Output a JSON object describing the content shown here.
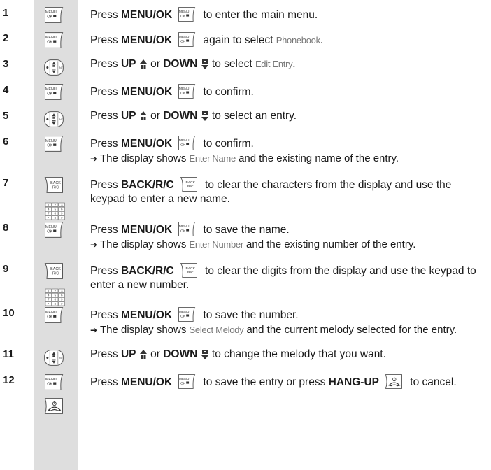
{
  "steps": [
    {
      "num": "1",
      "icons": [
        "menu-ok"
      ],
      "parts": [
        {
          "t": "Press "
        },
        {
          "b": "MENU/OK"
        },
        {
          "i": "menu-ok"
        },
        {
          "t": " to enter the main menu."
        }
      ]
    },
    {
      "num": "2",
      "icons": [
        "menu-ok"
      ],
      "parts": [
        {
          "t": "Press "
        },
        {
          "b": "MENU/OK"
        },
        {
          "i": "menu-ok"
        },
        {
          "t": " again to select "
        },
        {
          "k": "Phonebook"
        },
        {
          "t": "."
        }
      ]
    },
    {
      "num": "3",
      "icons": [
        "nav"
      ],
      "parts": [
        {
          "t": "Press "
        },
        {
          "b": "UP"
        },
        {
          "t": " "
        },
        {
          "i": "up"
        },
        {
          "t": " or "
        },
        {
          "b": "DOWN"
        },
        {
          "t": " "
        },
        {
          "i": "down"
        },
        {
          "t": " to select "
        },
        {
          "k": "Edit Entry"
        },
        {
          "t": "."
        }
      ]
    },
    {
      "num": "4",
      "icons": [
        "menu-ok"
      ],
      "parts": [
        {
          "t": "Press "
        },
        {
          "b": "MENU/OK"
        },
        {
          "i": "menu-ok"
        },
        {
          "t": " to confirm."
        }
      ]
    },
    {
      "num": "5",
      "icons": [
        "nav"
      ],
      "parts": [
        {
          "t": "Press "
        },
        {
          "b": "UP"
        },
        {
          "t": " "
        },
        {
          "i": "up"
        },
        {
          "t": " or "
        },
        {
          "b": "DOWN"
        },
        {
          "t": " "
        },
        {
          "i": "down"
        },
        {
          "t": " to select an entry."
        }
      ]
    },
    {
      "num": "6",
      "icons": [
        "menu-ok"
      ],
      "parts": [
        {
          "t": "Press "
        },
        {
          "b": "MENU/OK"
        },
        {
          "i": "menu-ok"
        },
        {
          "t": " to confirm."
        }
      ],
      "sub": [
        {
          "t": "The display shows "
        },
        {
          "k": "Enter Name"
        },
        {
          "t": " and the existing name of the entry."
        }
      ]
    },
    {
      "num": "7",
      "icons": [
        "back",
        "keypad"
      ],
      "wrap": true,
      "parts": [
        {
          "t": "Press "
        },
        {
          "b": "BACK/R/C"
        },
        {
          "i": "back"
        },
        {
          "t": " to clear the characters from the display and use the keypad to enter a new name."
        }
      ]
    },
    {
      "num": "8",
      "icons": [
        "menu-ok"
      ],
      "parts": [
        {
          "t": "Press "
        },
        {
          "b": "MENU/OK"
        },
        {
          "i": "menu-ok"
        },
        {
          "t": " to save the name."
        }
      ],
      "sub": [
        {
          "t": "The display shows "
        },
        {
          "k": "Enter Number"
        },
        {
          "t": " and the existing number of the entry."
        }
      ]
    },
    {
      "num": "9",
      "icons": [
        "back",
        "keypad"
      ],
      "wrap": true,
      "parts": [
        {
          "t": "Press "
        },
        {
          "b": "BACK/R/C"
        },
        {
          "i": "back"
        },
        {
          "t": " to clear the digits from the display and use the keypad to enter a new number."
        }
      ]
    },
    {
      "num": "10",
      "icons": [
        "menu-ok"
      ],
      "parts": [
        {
          "t": "Press "
        },
        {
          "b": "MENU/OK"
        },
        {
          "i": "menu-ok"
        },
        {
          "t": " to save the number."
        }
      ],
      "sub": [
        {
          "t": "The display shows "
        },
        {
          "k": "Select Melody"
        },
        {
          "t": " and the current melody selected for the entry."
        }
      ]
    },
    {
      "num": "11",
      "icons": [
        "nav"
      ],
      "parts": [
        {
          "t": "Press "
        },
        {
          "b": "UP"
        },
        {
          "t": " "
        },
        {
          "i": "up"
        },
        {
          "t": " or "
        },
        {
          "b": "DOWN"
        },
        {
          "t": " "
        },
        {
          "i": "down"
        },
        {
          "t": " to change the melody that you want."
        }
      ]
    },
    {
      "num": "12",
      "icons": [
        "menu-ok",
        "hangup"
      ],
      "wrap": true,
      "parts": [
        {
          "t": "Press "
        },
        {
          "b": "MENU/OK"
        },
        {
          "i": "menu-ok"
        },
        {
          "t": " to save the entry or press "
        },
        {
          "b": "HANG-UP"
        },
        {
          "i": "hangup"
        },
        {
          "t": " to cancel."
        }
      ]
    }
  ],
  "key_labels": {
    "menu_line1": "MENU",
    "menu_line2": "OK",
    "back_line1": "BACK",
    "back_line2": "R/C",
    "nav_side": "INT",
    "keypad_keys": [
      "1",
      "2",
      "3",
      "4",
      "5",
      "6",
      "7",
      "8",
      "9",
      "*",
      "0",
      "#"
    ]
  },
  "sub_arrow": "➔",
  "colors": {
    "icon_column": "#dedede",
    "keyword_gray": "#777777",
    "text": "#1a1a1a"
  }
}
